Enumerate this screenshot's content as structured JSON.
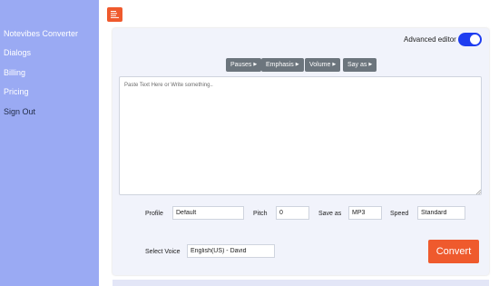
{
  "sidebar": {
    "items": [
      {
        "label": "Notevibes Converter"
      },
      {
        "label": "Dialogs"
      },
      {
        "label": "Billing"
      },
      {
        "label": "Pricing"
      },
      {
        "label": "Sign Out"
      }
    ]
  },
  "header": {
    "menu_icon": "menu-lines-icon"
  },
  "editor_panel": {
    "advanced_editor_label": "Advanced editor",
    "advanced_editor_on": true,
    "toolbar": [
      {
        "label": "Pauses"
      },
      {
        "label": "Emphasis"
      },
      {
        "label": "Volume"
      },
      {
        "label": "Say as"
      }
    ],
    "text_placeholder": "Paste Text Here or Write something..",
    "text_value": ""
  },
  "settings": {
    "profile_label": "Profile",
    "profile_value": "Default",
    "pitch_label": "Pitch",
    "pitch_value": "0",
    "save_as_label": "Save as",
    "save_as_value": "MP3",
    "speed_label": "Speed",
    "speed_value": "Standard",
    "select_voice_label": "Select Voice",
    "select_voice_value": "English(US) - David"
  },
  "actions": {
    "convert_label": "Convert"
  },
  "colors": {
    "sidebar_bg": "#9aaaf3",
    "accent_orange": "#ef5a2d",
    "toggle_blue": "#1e3df0",
    "tool_button_gray": "#6c757d",
    "panel_bg": "#f1f3fb"
  }
}
